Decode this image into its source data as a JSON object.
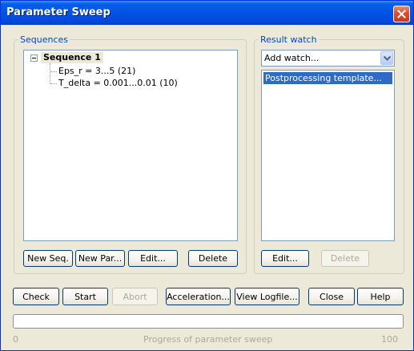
{
  "window": {
    "title": "Parameter Sweep"
  },
  "sequences": {
    "group_label": "Sequences",
    "tree": {
      "root_label": "Sequence 1",
      "children": [
        "Eps_r = 3...5 (21)",
        "T_delta = 0.001...0.01 (10)"
      ]
    },
    "buttons": {
      "new_seq": "New Seq.",
      "new_par": "New Par...",
      "edit": "Edit...",
      "delete": "Delete"
    }
  },
  "result_watch": {
    "group_label": "Result watch",
    "dropdown_value": "Add watch...",
    "items": [
      "Postprocessing template..."
    ],
    "buttons": {
      "edit": "Edit...",
      "delete": "Delete"
    }
  },
  "bottom_buttons": {
    "check": "Check",
    "start": "Start",
    "abort": "Abort",
    "acceleration": "Acceleration...",
    "view_logfile": "View Logfile...",
    "close": "Close",
    "help": "Help"
  },
  "progress": {
    "label": "Progress of parameter sweep",
    "min": "0",
    "max": "100",
    "value": 0
  },
  "colors": {
    "titlebar": "#0054E3",
    "group_label": "#0046D5",
    "selection": "#316AC5",
    "dialog_bg": "#ECE9D8"
  },
  "icons": [
    "close-icon",
    "expander-minus-icon",
    "dropdown-arrow-icon"
  ]
}
